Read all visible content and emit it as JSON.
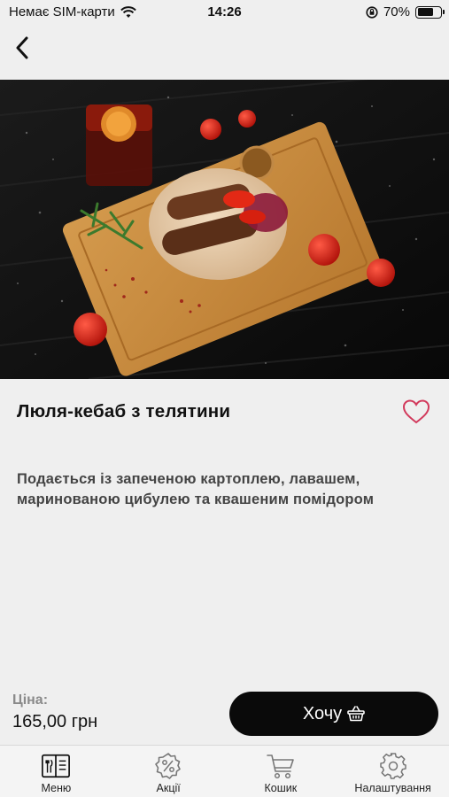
{
  "status": {
    "carrier": "Немає SIM-карти",
    "time": "14:26",
    "battery": "70%",
    "battery_level": 0.7
  },
  "product": {
    "title": "Люля-кебаб з телятини",
    "description": "Подається із запеченою картоплею, лавашем, маринованою цибулею та квашеним помідором",
    "image_alt": "Люля-кебаб з телятини",
    "favorite_icon": "heart-outline-icon",
    "accent_color": "#d23a5c"
  },
  "purchase": {
    "price_label": "Ціна:",
    "price_value": "165,00 грн",
    "button_label": "Хочу",
    "button_icon": "basket-icon"
  },
  "tabs": [
    {
      "label": "Меню",
      "icon": "menu-book-icon",
      "active": true
    },
    {
      "label": "Акції",
      "icon": "discount-icon",
      "active": false
    },
    {
      "label": "Кошик",
      "icon": "cart-icon",
      "active": false
    },
    {
      "label": "Налаштування",
      "icon": "gear-icon",
      "active": false
    }
  ]
}
